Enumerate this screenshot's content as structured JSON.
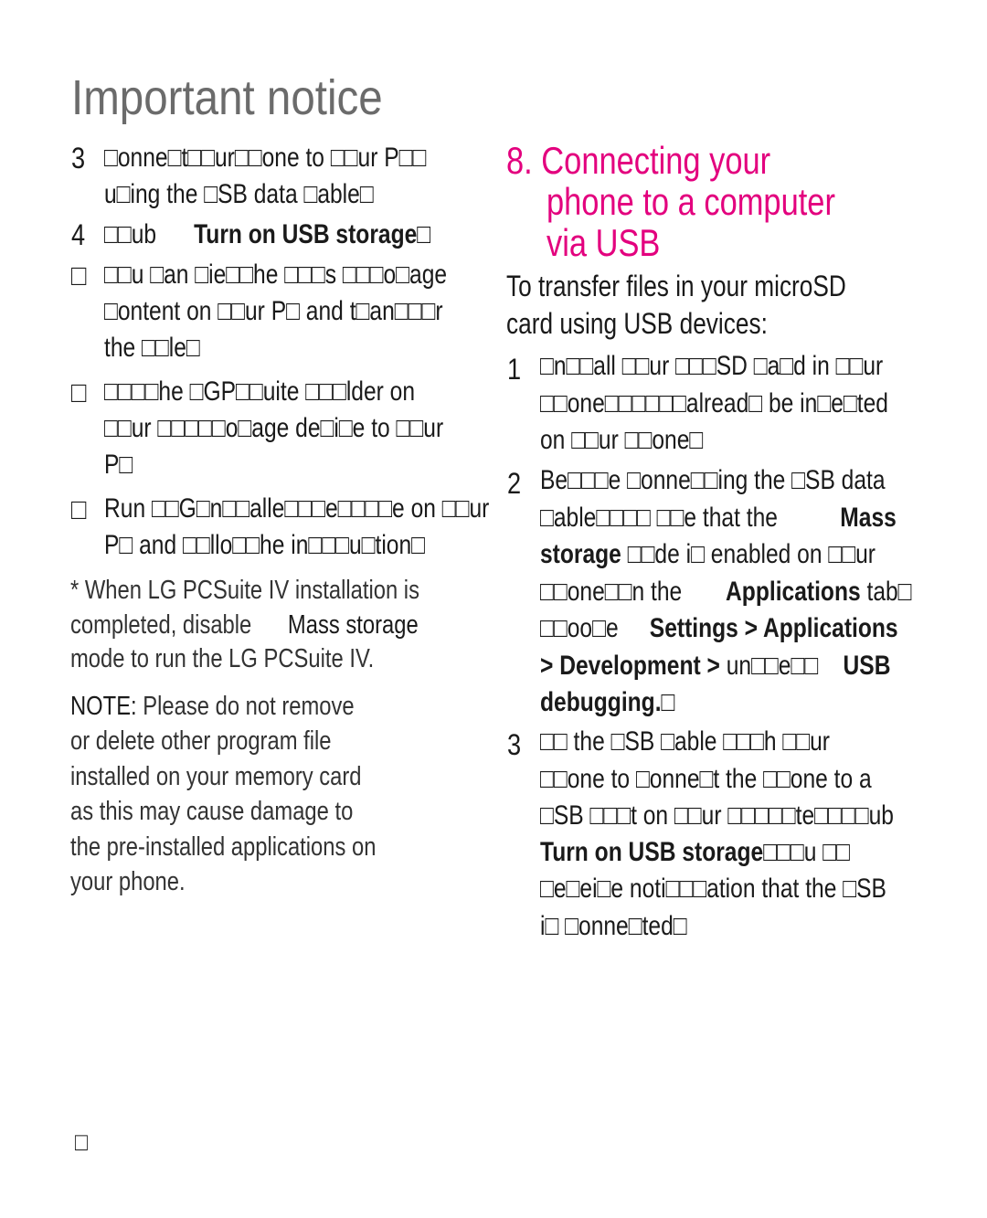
{
  "page_title": "Important notice",
  "left": {
    "steps": [
      {
        "num": "3",
        "lines": [
          [
            {
              "t": "□onne□t□□ur□□one to □□ur P□□"
            }
          ],
          [
            {
              "t": "u□ing the □SB data □able□"
            }
          ]
        ]
      },
      {
        "num": "4",
        "lines": [
          [
            {
              "t": "□□ub      "
            },
            {
              "t": "Turn on USB storage□",
              "b": true
            }
          ]
        ]
      },
      {
        "num": "□",
        "lines": [
          [
            {
              "t": "□□u □an □ie□□he □□□s □□□o□age"
            }
          ],
          [
            {
              "t": "□ontent on □□ur P□ and t□an□□□r"
            }
          ],
          [
            {
              "t": "the □□le□"
            }
          ]
        ]
      },
      {
        "num": "□",
        "lines": [
          [
            {
              "t": "□□□□he □GP□□uite □□□lder on"
            }
          ],
          [
            {
              "t": "□□ur □□□□□o□age de□i□e to □□ur"
            }
          ],
          [
            {
              "t": "P□"
            }
          ]
        ]
      },
      {
        "num": "□",
        "lines": [
          [
            {
              "t": "Run □□G□n□□alle□□□e□□□□e on □□ur"
            }
          ],
          [
            {
              "t": "P□ and □□llo□□he in□□□u□tion□"
            }
          ]
        ]
      }
    ],
    "footnote": [
      [
        {
          "t": "* When LG PCSuite IV installation is"
        }
      ],
      [
        {
          "t": "completed, disable      "
        },
        {
          "t": "Mass storage",
          "dark": true
        }
      ],
      [
        {
          "t": "mode to run the LG PCSuite IV."
        }
      ]
    ],
    "note": [
      [
        {
          "t": "NOTE:",
          "dark": true
        },
        {
          "t": " Please do not remove"
        }
      ],
      [
        {
          "t": "or delete other program file"
        }
      ],
      [
        {
          "t": "installed on your memory card"
        }
      ],
      [
        {
          "t": "as this may cause damage to"
        }
      ],
      [
        {
          "t": "the pre-installed applications on"
        }
      ],
      [
        {
          "t": "your phone."
        }
      ]
    ]
  },
  "right": {
    "section_title": [
      "8. Connecting your",
      "phone to a computer",
      "via USB"
    ],
    "subtitle": [
      "To transfer files in your microSD",
      "card using USB devices:"
    ],
    "steps": [
      {
        "num": "1",
        "lines": [
          [
            {
              "t": "□n□□all □□ur □□□SD □a□d in □□ur"
            }
          ],
          [
            {
              "t": "□□one□□□□□□alread□ be in□e□ted"
            }
          ],
          [
            {
              "t": "on □□ur □□one□"
            }
          ]
        ]
      },
      {
        "num": "2",
        "lines": [
          [
            {
              "t": "Be□□□e □onne□□ing the □SB data"
            }
          ],
          [
            {
              "t": "□able□□□□ □□e that the          "
            },
            {
              "t": "Mass",
              "b": true
            }
          ],
          [
            {
              "t": "storage ",
              "b": true
            },
            {
              "t": "□□de i□ enabled on □□ur"
            }
          ],
          [
            {
              "t": "□□one□□n the       "
            },
            {
              "t": "Applications",
              "b": true
            },
            {
              "t": " tab□"
            }
          ],
          [
            {
              "t": "□□oo□e     "
            },
            {
              "t": "Settings > Applications",
              "b": true
            }
          ],
          [
            {
              "t": "> Development >",
              "b": true
            },
            {
              "t": " un□□e□□    "
            },
            {
              "t": "USB",
              "b": true
            }
          ],
          [
            {
              "t": "debugging.",
              "b": true
            },
            {
              "t": "□"
            }
          ]
        ]
      },
      {
        "num": "3",
        "lines": [
          [
            {
              "t": "□□ the □SB □able □□□h □□ur"
            }
          ],
          [
            {
              "t": "□□one to □onne□t the □□one to a"
            }
          ],
          [
            {
              "t": "□SB □□□t on □□ur □□□□□te□□□□ub"
            }
          ],
          [
            {
              "t": "Turn on USB storage",
              "b": true
            },
            {
              "t": "□□□u □□"
            }
          ],
          [
            {
              "t": "□e□ei□e noti□□□ation that the □SB"
            }
          ],
          [
            {
              "t": "i□ □onne□ted□"
            }
          ]
        ]
      }
    ]
  },
  "page_number": "□",
  "colors": {
    "accent": "#e3007e",
    "title_gray": "#6b6b6b",
    "text": "#1a1a1a"
  }
}
